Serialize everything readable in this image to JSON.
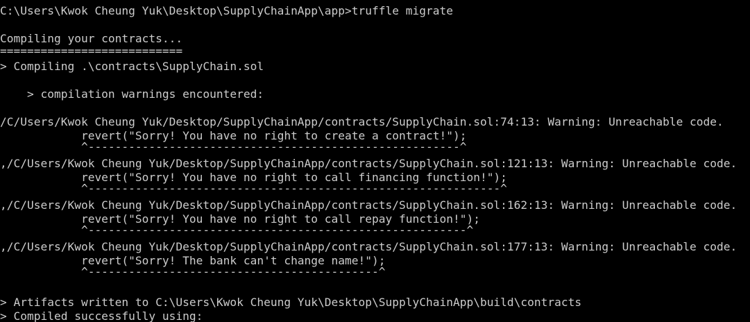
{
  "terminal": {
    "background": "#000000",
    "foreground": "#cccccc",
    "lines": [
      "C:\\Users\\Kwok Cheung Yuk\\Desktop\\SupplyChainApp\\app>truffle migrate",
      "",
      "Compiling your contracts...",
      "===========================",
      "> Compiling .\\contracts\\SupplyChain.sol",
      "",
      "    > compilation warnings encountered:",
      "",
      "/C/Users/Kwok Cheung Yuk/Desktop/SupplyChainApp/contracts/SupplyChain.sol:74:13: Warning: Unreachable code.",
      "            revert(\"Sorry! You have no right to create a contract!\");",
      "            ^-------------------------------------------------------^",
      ",/C/Users/Kwok Cheung Yuk/Desktop/SupplyChainApp/contracts/SupplyChain.sol:121:13: Warning: Unreachable code.",
      "            revert(\"Sorry! You have no right to call financing function!\");",
      "            ^-------------------------------------------------------------^",
      ",/C/Users/Kwok Cheung Yuk/Desktop/SupplyChainApp/contracts/SupplyChain.sol:162:13: Warning: Unreachable code.",
      "            revert(\"Sorry! You have no right to call repay function!\");",
      "            ^--------------------------------------------------------^",
      ",/C/Users/Kwok Cheung Yuk/Desktop/SupplyChainApp/contracts/SupplyChain.sol:177:13: Warning: Unreachable code.",
      "            revert(\"Sorry! The bank can't change name!\");",
      "            ^-------------------------------------------^",
      "",
      "",
      "> Artifacts written to C:\\Users\\Kwok Cheung Yuk\\Desktop\\SupplyChainApp\\build\\contracts",
      "> Compiled successfully using:"
    ]
  }
}
